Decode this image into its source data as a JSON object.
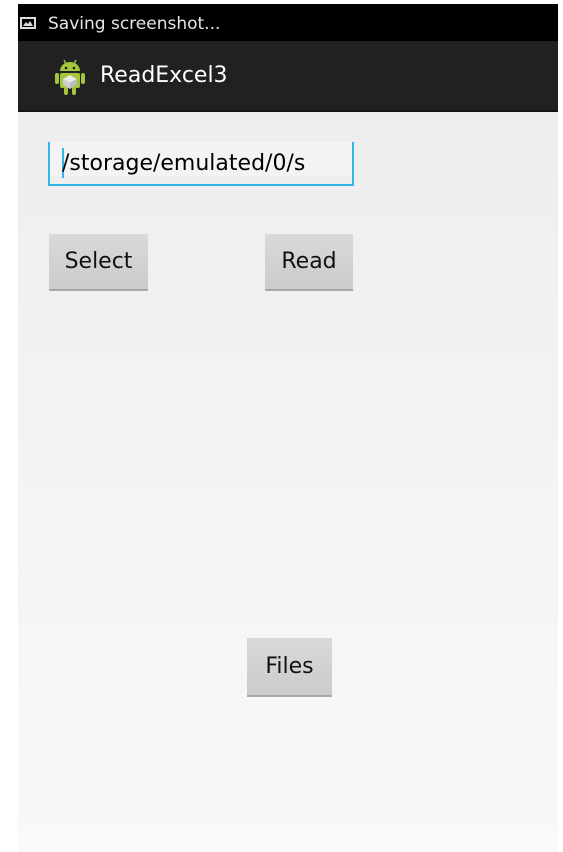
{
  "status_bar": {
    "notification_icon": "screenshot-icon",
    "text": "Saving screenshot..."
  },
  "action_bar": {
    "app_icon": "android-icon",
    "title": "ReadExcel3"
  },
  "path_field": {
    "value": "/storage/emulated/0/s",
    "accent_color": "#33b5e5"
  },
  "buttons": {
    "select_label": "Select",
    "read_label": "Read",
    "files_label": "Files"
  }
}
